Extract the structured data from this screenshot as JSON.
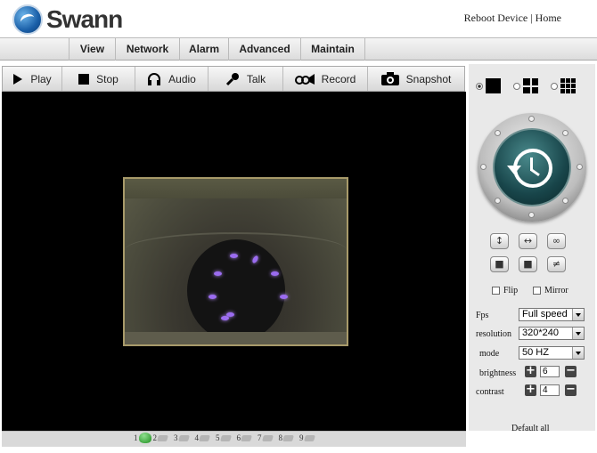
{
  "brand": {
    "name": "Swann"
  },
  "top_links": {
    "reboot": "Reboot Device",
    "separator": "|",
    "home": "Home"
  },
  "nav": [
    {
      "label": "View"
    },
    {
      "label": "Network"
    },
    {
      "label": "Alarm"
    },
    {
      "label": "Advanced"
    },
    {
      "label": "Maintain"
    }
  ],
  "toolbar": {
    "play": "Play",
    "stop": "Stop",
    "audio": "Audio",
    "talk": "Talk",
    "record": "Record",
    "snapshot": "Snapshot"
  },
  "layout_options": {
    "selected": "single"
  },
  "ptz": {
    "label_icon": "clock-history-icon"
  },
  "controls": {
    "flip": "Flip",
    "mirror": "Mirror"
  },
  "settings": {
    "fps_label": "Fps",
    "fps_value": "Full speed",
    "resolution_label": "resolution",
    "resolution_value": "320*240",
    "mode_label": "mode",
    "mode_value": "50 HZ",
    "brightness_label": "brightness",
    "brightness_value": "6",
    "contrast_label": "contrast",
    "contrast_value": "4",
    "default_all": "Default all"
  },
  "channels": [
    {
      "num": "1",
      "active": true
    },
    {
      "num": "2",
      "active": false
    },
    {
      "num": "3",
      "active": false
    },
    {
      "num": "4",
      "active": false
    },
    {
      "num": "5",
      "active": false
    },
    {
      "num": "6",
      "active": false
    },
    {
      "num": "7",
      "active": false
    },
    {
      "num": "8",
      "active": false
    },
    {
      "num": "9",
      "active": false
    }
  ],
  "colors": {
    "video_bg": "#000000",
    "led": "#9b6cf0",
    "active_channel": "#1f8f1f"
  }
}
